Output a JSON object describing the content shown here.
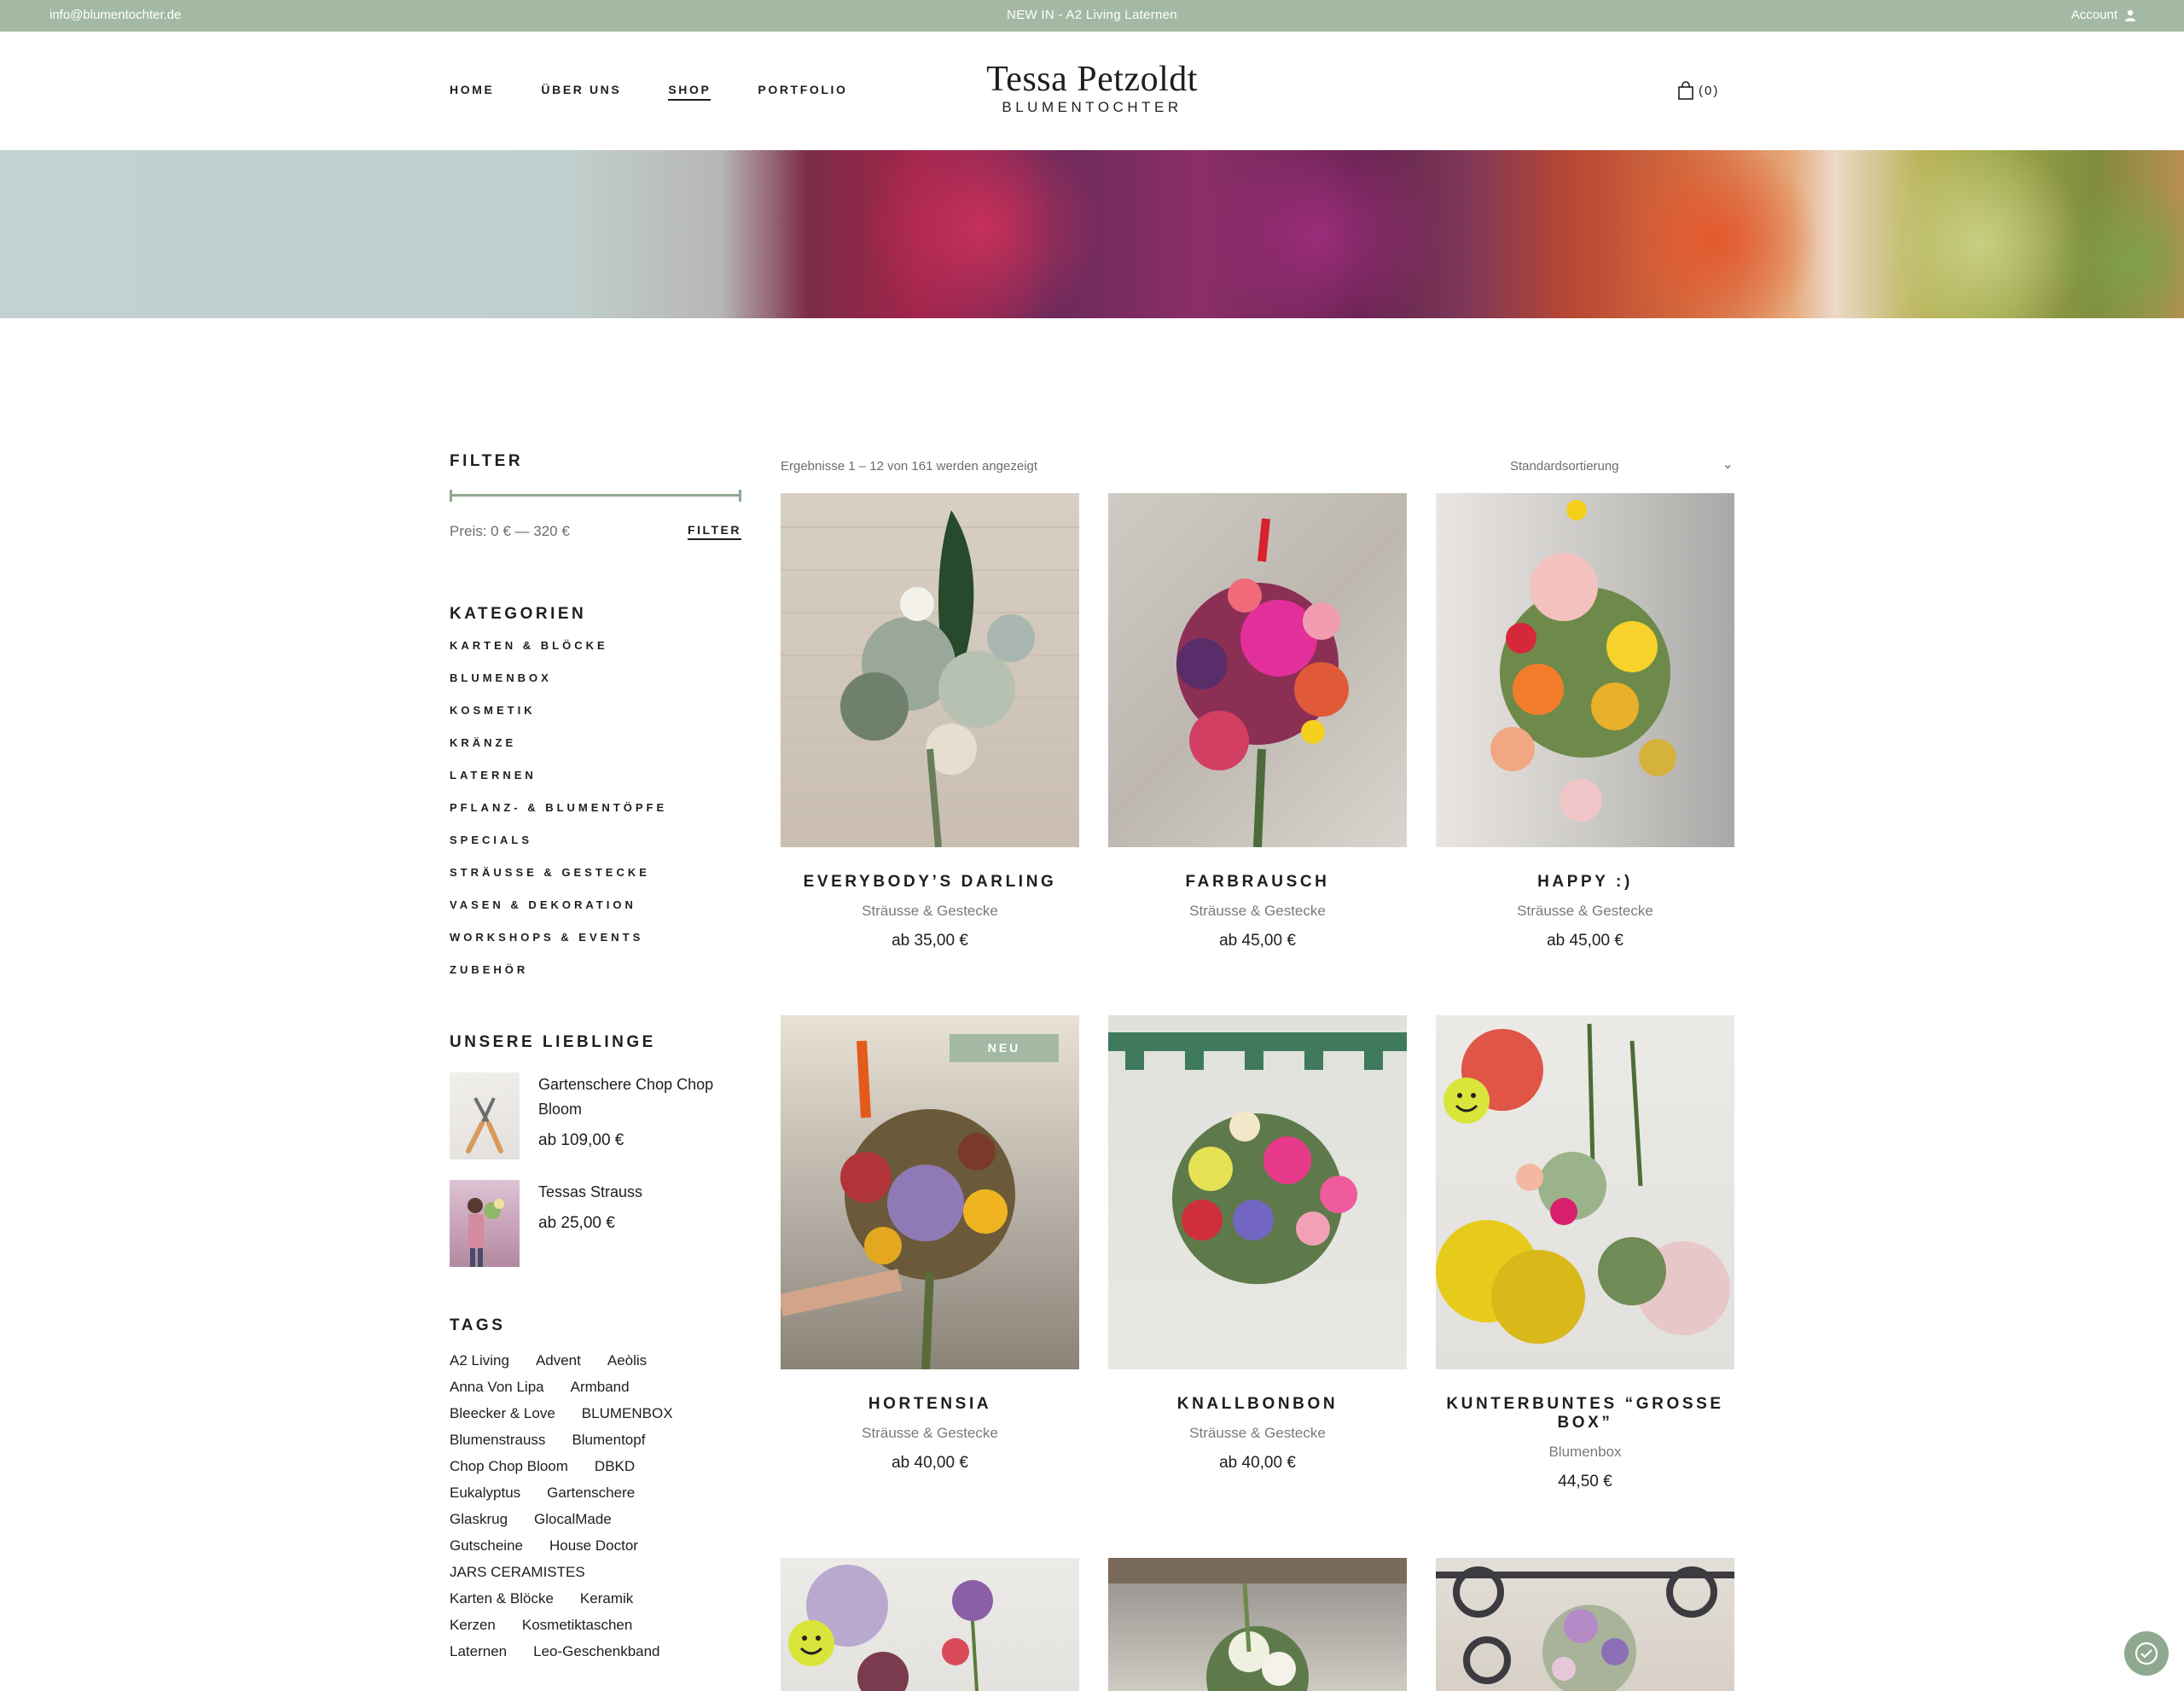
{
  "topbar": {
    "email": "info@blumentochter.de",
    "promo": "NEW IN - A2 Living Laternen",
    "account": "Account"
  },
  "nav": [
    "HOME",
    "ÜBER UNS",
    "SHOP",
    "PORTFOLIO"
  ],
  "nav_active": "SHOP",
  "logo": {
    "line1": "Tessa Petzoldt",
    "line2": "BLUMENTOCHTER"
  },
  "cart": {
    "count": "(0)"
  },
  "filter": {
    "title": "FILTER",
    "price_label": "Preis: 0 € — 320 €",
    "button": "FILTER"
  },
  "categories": {
    "title": "KATEGORIEN",
    "items": [
      "KARTEN & BLÖCKE",
      "BLUMENBOX",
      "KOSMETIK",
      "KRÄNZE",
      "LATERNEN",
      "PFLANZ- & BLUMENTÖPFE",
      "SPECIALS",
      "STRÄUSSE & GESTECKE",
      "VASEN & DEKORATION",
      "WORKSHOPS & EVENTS",
      "ZUBEHÖR"
    ]
  },
  "favorites": {
    "title": "UNSERE LIEBLINGE",
    "items": [
      {
        "name": "Gartenschere Chop Chop Bloom",
        "price": "ab 109,00 €"
      },
      {
        "name": "Tessas Strauss",
        "price": "ab 25,00 €"
      }
    ]
  },
  "tags": {
    "title": "TAGS",
    "items": [
      "A2 Living",
      "Advent",
      "Aeòlis",
      "Anna Von Lipa",
      "Armband",
      "Bleecker & Love",
      "BLUMENBOX",
      "Blumenstrauss",
      "Blumentopf",
      "Chop Chop Bloom",
      "DBKD",
      "Eukalyptus",
      "Gartenschere",
      "Glaskrug",
      "GlocalMade",
      "Gutscheine",
      "House Doctor",
      "JARS CERAMISTES",
      "Karten & Blöcke",
      "Keramik",
      "Kerzen",
      "Kosmetiktaschen",
      "Laternen",
      "Leo-Geschenkband"
    ]
  },
  "results_text": "Ergebnisse 1 – 12 von 161 werden angezeigt",
  "sort_label": "Standardsortierung",
  "products": [
    {
      "name": "EVERYBODY’S DARLING",
      "category": "Sträusse & Gestecke",
      "price": "ab 35,00 €",
      "badge": ""
    },
    {
      "name": "FARBRAUSCH",
      "category": "Sträusse & Gestecke",
      "price": "ab 45,00 €",
      "badge": ""
    },
    {
      "name": "HAPPY :)",
      "category": "Sträusse & Gestecke",
      "price": "ab 45,00 €",
      "badge": ""
    },
    {
      "name": "HORTENSIA",
      "category": "Sträusse & Gestecke",
      "price": "ab 40,00 €",
      "badge": "NEU"
    },
    {
      "name": "KNALLBONBON",
      "category": "Sträusse & Gestecke",
      "price": "ab 40,00 €",
      "badge": ""
    },
    {
      "name": "KUNTERBUNTES “GROSSE BOX”",
      "category": "Blumenbox",
      "price": "44,50 €",
      "badge": ""
    }
  ],
  "colors": {
    "accent": "#a4b9a3",
    "text": "#1e1e1e",
    "muted": "#7a7a7a"
  }
}
